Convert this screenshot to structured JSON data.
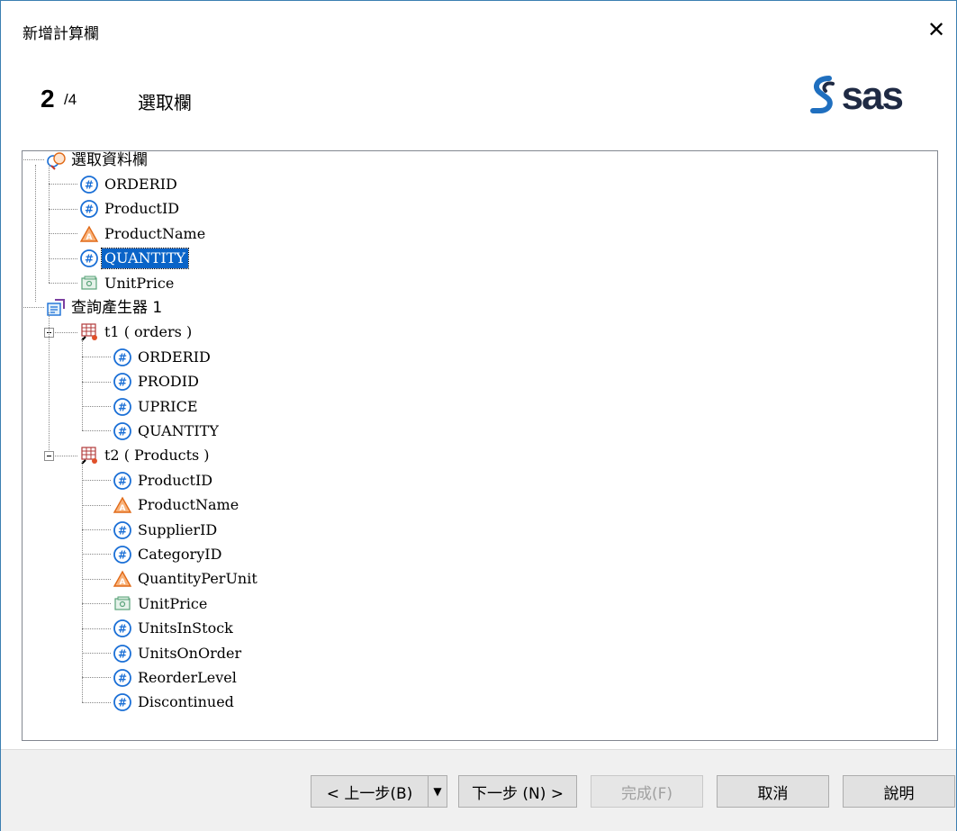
{
  "window": {
    "title": "新增計算欄",
    "close_glyph": "✕"
  },
  "wizard": {
    "step": "2",
    "total": "/4",
    "step_title": "選取欄"
  },
  "logo": {
    "text": "sas"
  },
  "tree": {
    "selected_columns": {
      "label": "選取資料欄",
      "items": [
        {
          "label": "ORDERID",
          "type": "numeric"
        },
        {
          "label": "ProductID",
          "type": "numeric"
        },
        {
          "label": "ProductName",
          "type": "character"
        },
        {
          "label": "QUANTITY",
          "type": "numeric",
          "selected": true
        },
        {
          "label": "UnitPrice",
          "type": "currency"
        }
      ]
    },
    "query_builder": {
      "label": "查詢產生器 1",
      "tables": [
        {
          "label": "t1 ( orders )",
          "items": [
            {
              "label": "ORDERID",
              "type": "numeric"
            },
            {
              "label": "PRODID",
              "type": "numeric"
            },
            {
              "label": "UPRICE",
              "type": "numeric"
            },
            {
              "label": "QUANTITY",
              "type": "numeric"
            }
          ]
        },
        {
          "label": "t2 ( Products )",
          "items": [
            {
              "label": "ProductID",
              "type": "numeric"
            },
            {
              "label": "ProductName",
              "type": "character"
            },
            {
              "label": "SupplierID",
              "type": "numeric"
            },
            {
              "label": "CategoryID",
              "type": "numeric"
            },
            {
              "label": "QuantityPerUnit",
              "type": "character"
            },
            {
              "label": "UnitPrice",
              "type": "currency"
            },
            {
              "label": "UnitsInStock",
              "type": "numeric"
            },
            {
              "label": "UnitsOnOrder",
              "type": "numeric"
            },
            {
              "label": "ReorderLevel",
              "type": "numeric"
            },
            {
              "label": "Discontinued",
              "type": "numeric"
            }
          ]
        }
      ]
    }
  },
  "buttons": {
    "back": "< 上一步(B)",
    "back_dropdown": "▼",
    "next": "下一步 (N) >",
    "finish": "完成(F)",
    "cancel": "取消",
    "help": "說明"
  },
  "colors": {
    "selection": "#0a64c8",
    "numeric_icon": "#1a6fd6",
    "character_icon": "#f07a22",
    "currency_icon": "#5aa37a"
  }
}
